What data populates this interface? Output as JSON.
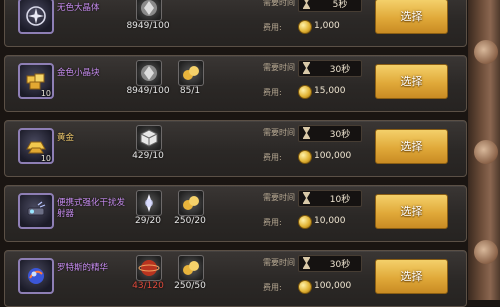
{
  "labels": {
    "time": "需要时间",
    "cost": "费用:",
    "select": "选择"
  },
  "colors": {
    "rare_name": "#c78cf0",
    "gold_name": "#e9c46a",
    "insufficient": "#e04a3c",
    "button": "#e0a939"
  },
  "rows": [
    {
      "name": "无色大晶体",
      "name_color": "rare",
      "icon": "colorless-crystal-icon",
      "qty": "",
      "materials": [
        {
          "icon": "silver-crystal-icon",
          "count": "8949/100",
          "insufficient": false
        }
      ],
      "time": "5秒",
      "cost": "1,000"
    },
    {
      "name": "金色小晶块",
      "name_color": "rare",
      "icon": "gold-crystal-block-icon",
      "qty": "10",
      "materials": [
        {
          "icon": "silver-crystal-icon",
          "count": "8949/100",
          "insufficient": false
        },
        {
          "icon": "gold-ore-icon",
          "count": "85/1",
          "insufficient": false
        }
      ],
      "time": "30秒",
      "cost": "15,000"
    },
    {
      "name": "黄金",
      "name_color": "gold",
      "icon": "gold-bar-icon",
      "qty": "10",
      "materials": [
        {
          "icon": "white-cube-icon",
          "count": "429/10",
          "insufficient": false
        }
      ],
      "time": "30秒",
      "cost": "100,000"
    },
    {
      "name": "便携式强化干扰发射器",
      "name_color": "rare",
      "icon": "jammer-device-icon",
      "qty": "",
      "materials": [
        {
          "icon": "light-shard-icon",
          "count": "29/20",
          "insufficient": false
        },
        {
          "icon": "gold-ore-icon",
          "count": "250/20",
          "insufficient": false
        }
      ],
      "time": "10秒",
      "cost": "10,000"
    },
    {
      "name": "罗特斯的精华",
      "name_color": "rare",
      "icon": "essence-orb-icon",
      "qty": "",
      "materials": [
        {
          "icon": "red-orb-icon",
          "count": "43/120",
          "insufficient": true
        },
        {
          "icon": "gold-ore-icon",
          "count": "250/50",
          "insufficient": false
        }
      ],
      "time": "30秒",
      "cost": "100,000"
    }
  ]
}
